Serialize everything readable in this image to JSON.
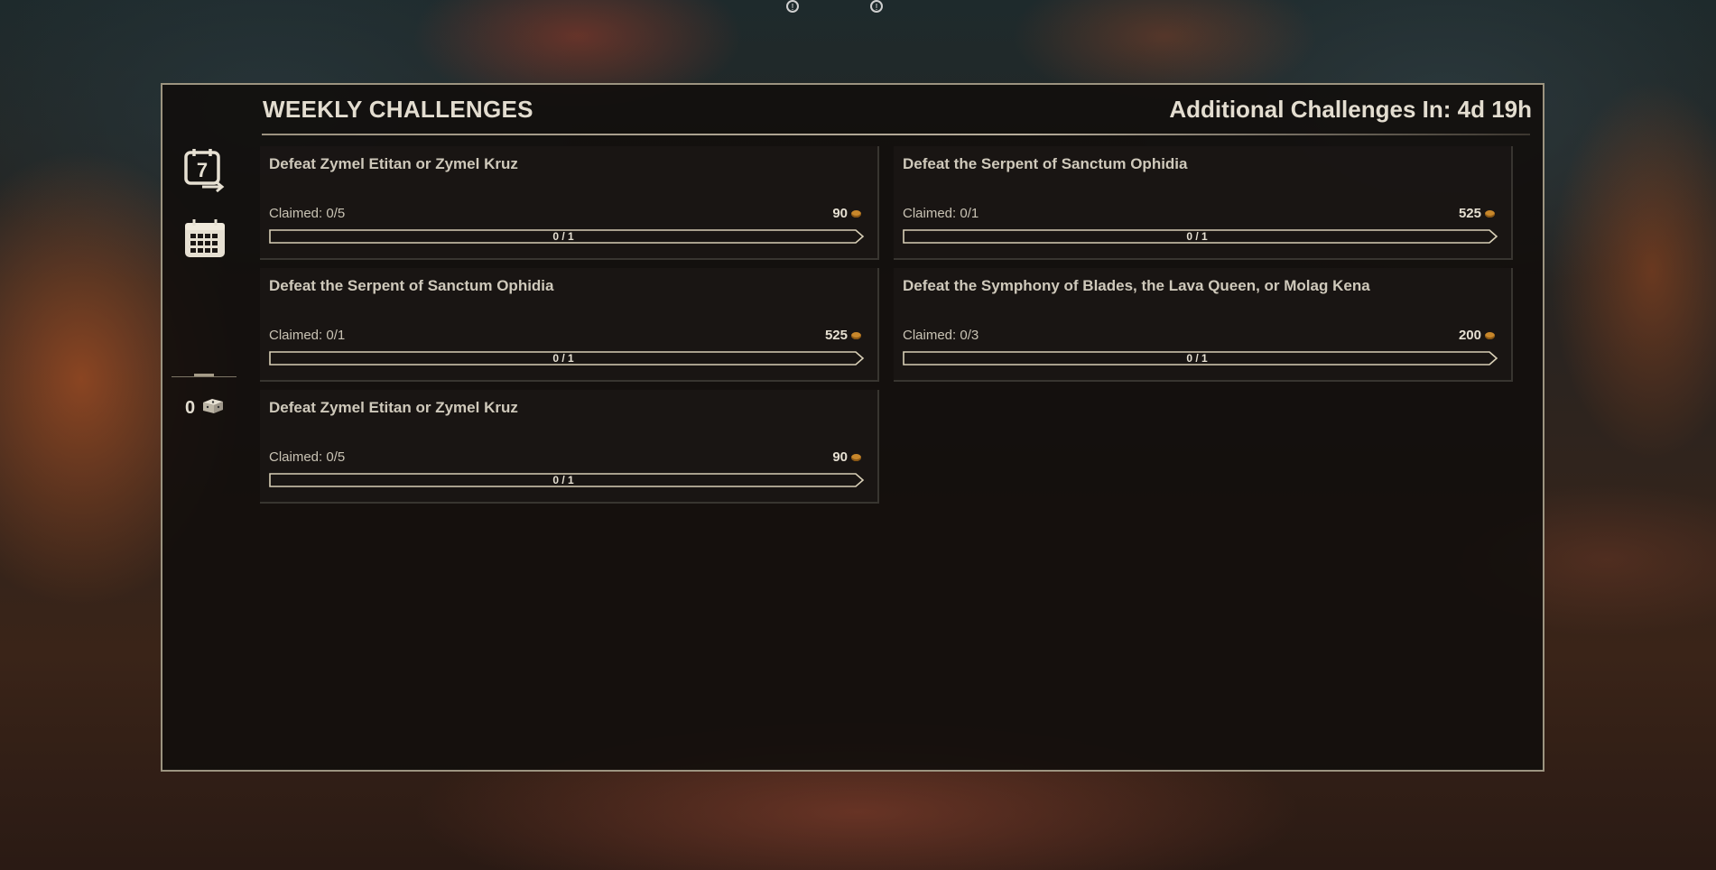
{
  "header": {
    "title": "WEEKLY CHALLENGES",
    "timer": "Additional Challenges In: 4d 19h"
  },
  "sidebar": {
    "items": [
      {
        "icon": "weekly-calendar-icon",
        "label": "7"
      },
      {
        "icon": "calendar-grid-icon"
      }
    ],
    "currency": {
      "value": "0",
      "icon": "seals-currency-icon"
    }
  },
  "colors": {
    "panel_border": "#9c9480",
    "panel_bg": "#120e0c",
    "text": "#d8d2c2",
    "coin": "#c8872b"
  },
  "challenges": [
    {
      "title": "Defeat Zymel Etitan or Zymel Kruz",
      "claimed": "Claimed: 0/5",
      "reward": "90",
      "progress_text": "0 / 1",
      "progress": 0
    },
    {
      "title": "Defeat the Serpent of Sanctum Ophidia",
      "claimed": "Claimed: 0/1",
      "reward": "525",
      "progress_text": "0 / 1",
      "progress": 0
    },
    {
      "title": "Defeat the Serpent of Sanctum Ophidia",
      "claimed": "Claimed: 0/1",
      "reward": "525",
      "progress_text": "0 / 1",
      "progress": 0
    },
    {
      "title": "Defeat the Symphony of Blades, the Lava Queen, or Molag Kena",
      "claimed": "Claimed: 0/3",
      "reward": "200",
      "progress_text": "0 / 1",
      "progress": 0
    },
    {
      "title": "Defeat Zymel Etitan or Zymel Kruz",
      "claimed": "Claimed: 0/5",
      "reward": "90",
      "progress_text": "0 / 1",
      "progress": 0
    }
  ]
}
